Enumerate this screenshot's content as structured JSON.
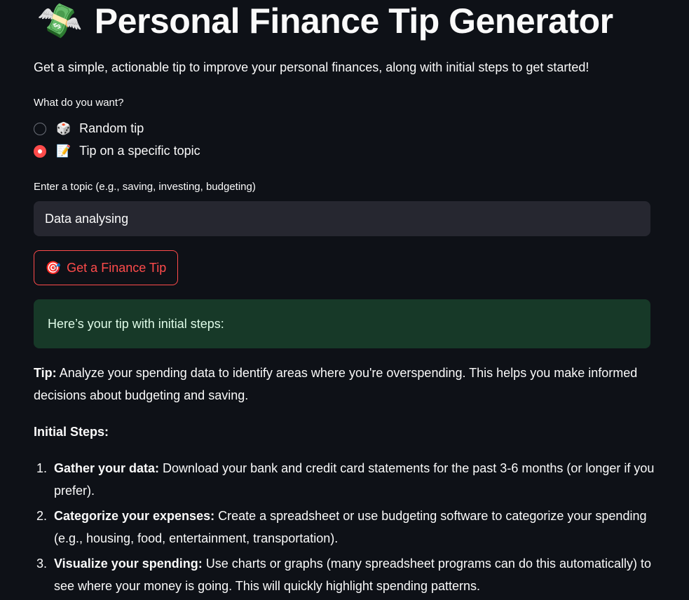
{
  "header": {
    "emoji": "💸",
    "title": "Personal Finance Tip Generator",
    "subtitle": "Get a simple, actionable tip to improve your personal finances, along with initial steps to get started!"
  },
  "mode": {
    "label": "What do you want?",
    "options": [
      {
        "icon": "🎲",
        "label": "Random tip",
        "selected": false
      },
      {
        "icon": "📝",
        "label": "Tip on a specific topic",
        "selected": true
      }
    ]
  },
  "topic": {
    "label": "Enter a topic (e.g., saving, investing, budgeting)",
    "value": "Data analysing"
  },
  "button": {
    "icon": "🎯",
    "label": "Get a Finance Tip"
  },
  "result": {
    "success_message": "Here’s your tip with initial steps:",
    "tip_label": "Tip:",
    "tip_text": "Analyze your spending data to identify areas where you're overspending. This helps you make informed decisions about budgeting and saving.",
    "steps_heading": "Initial Steps:",
    "steps": [
      {
        "num": "1.",
        "title": "Gather your data:",
        "text": "Download your bank and credit card statements for the past 3-6 months (or longer if you prefer)."
      },
      {
        "num": "2.",
        "title": "Categorize your expenses:",
        "text": "Create a spreadsheet or use budgeting software to categorize your spending (e.g., housing, food, entertainment, transportation)."
      },
      {
        "num": "3.",
        "title": "Visualize your spending:",
        "text": "Use charts or graphs (many spreadsheet programs can do this automatically) to see where your money is going. This will quickly highlight spending patterns."
      }
    ]
  },
  "colors": {
    "background": "#0e1117",
    "accent": "#ff4b4b",
    "input_bg": "#262730",
    "success_bg": "#173928"
  }
}
